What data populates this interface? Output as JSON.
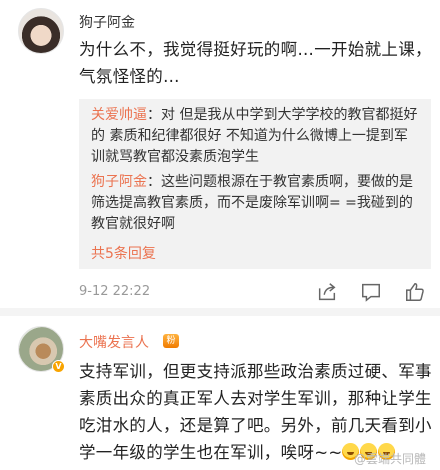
{
  "comments": [
    {
      "username": "狗子阿金",
      "text": "为什么不，我觉得挺好玩的啊…一开始就上课，气氛怪怪的…",
      "replies": [
        {
          "name": "关爱帅逼",
          "text": "对  但是我从中学到大学学校的教官都挺好的    素质和纪律都很好  不知道为什么微博上一提到军训就骂教官都没素质泡学生"
        },
        {
          "name": "狗子阿金",
          "text": "这些问题根源在于教官素质啊，要做的是筛选提高教官素质，而不是废除军训啊=  =我碰到的教官就很好啊"
        }
      ],
      "more_replies": "共5条回复",
      "timestamp": "9-12 22:22"
    },
    {
      "username": "大嘴发言人",
      "fan_badge": "粉",
      "text": "支持军训，但更支持派那些政治素质过硬、军事素质出众的真正军人去对学生军训，那种让学生吃泔水的人，还是算了吧。另外，前几天看到小学一年级的学生也在军训，唉呀~~"
    }
  ],
  "verified_badge": "V",
  "watermark": "@雲端共同體",
  "icons": {
    "share": "share-icon",
    "comment": "comment-icon",
    "like": "thumbs-up-icon",
    "emoji": "grinning-face-icon"
  },
  "colors": {
    "link": "#eb7350",
    "meta": "#999999",
    "reply_bg": "#f2f2f2"
  }
}
